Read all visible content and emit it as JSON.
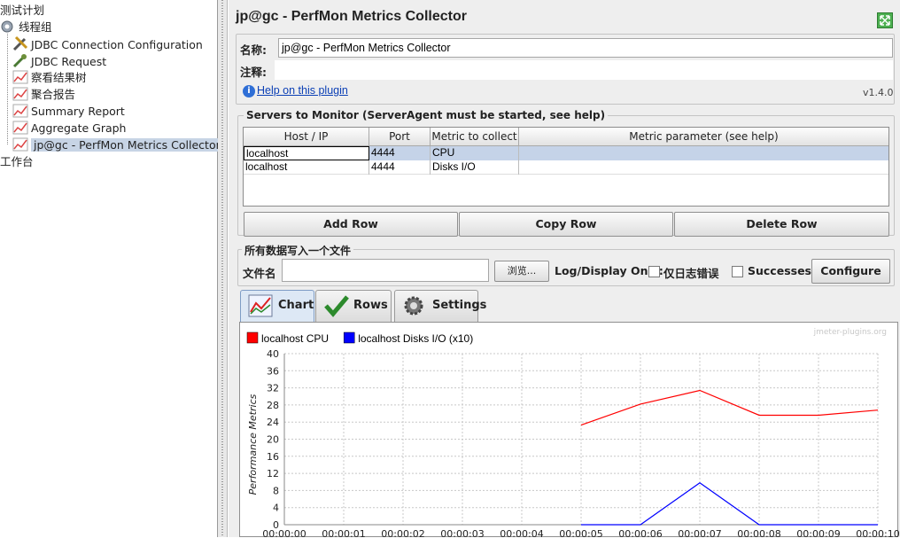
{
  "tree": {
    "root": "测试计划",
    "thread_group": "线程组",
    "children": [
      {
        "label": "JDBC Connection Configuration",
        "icon": "wrench-icon"
      },
      {
        "label": "JDBC Request",
        "icon": "pipette-icon"
      },
      {
        "label": "察看结果树",
        "icon": "graph-icon"
      },
      {
        "label": "聚合报告",
        "icon": "graph-icon"
      },
      {
        "label": "Summary Report",
        "icon": "graph-icon"
      },
      {
        "label": "Aggregate Graph",
        "icon": "graph-icon"
      },
      {
        "label": "jp@gc - PerfMon Metrics Collector",
        "icon": "graph-icon"
      }
    ],
    "workbench": "工作台"
  },
  "panel": {
    "title": "jp@gc - PerfMon Metrics Collector",
    "name_label": "名称:",
    "name_value": "jp@gc - PerfMon Metrics Collector",
    "comment_label": "注释:",
    "help_link": "Help on this plugin",
    "version": "v1.4.0"
  },
  "servers": {
    "group_title": "Servers to Monitor (ServerAgent must be started, see help)",
    "columns": [
      "Host / IP",
      "Port",
      "Metric to collect",
      "Metric parameter (see help)"
    ],
    "rows": [
      [
        "localhost",
        "4444",
        "CPU",
        ""
      ],
      [
        "localhost",
        "4444",
        "Disks I/O",
        ""
      ]
    ],
    "add_row": "Add Row",
    "copy_row": "Copy Row",
    "delete_row": "Delete Row"
  },
  "file": {
    "group_title": "所有数据写入一个文件",
    "filename_label": "文件名",
    "browse": "浏览...",
    "log_display_only": "Log/Display Only:",
    "errors_only": "仅日志错误",
    "successes": "Successes",
    "configure": "Configure"
  },
  "tabs": [
    {
      "label": "Chart",
      "icon": "chart-icon",
      "active": true
    },
    {
      "label": "Rows",
      "icon": "checkmark-icon",
      "active": false
    },
    {
      "label": "Settings",
      "icon": "gear-icon",
      "active": false
    }
  ],
  "chart_data": {
    "type": "line",
    "watermark": "jmeter-plugins.org",
    "ylabel": "Performance Metrics",
    "ylim": [
      0,
      40
    ],
    "yticks": [
      0,
      4,
      8,
      12,
      16,
      20,
      24,
      28,
      32,
      36,
      40
    ],
    "x": [
      "00:00:00",
      "00:00:01",
      "00:00:02",
      "00:00:03",
      "00:00:04",
      "00:00:05",
      "00:00:06",
      "00:00:07",
      "00:00:08",
      "00:00:09",
      "00:00:10"
    ],
    "series": [
      {
        "name": "localhost CPU",
        "color": "#ff0000",
        "points": [
          [
            5,
            23.3
          ],
          [
            6,
            28.2
          ],
          [
            7,
            31.4
          ],
          [
            8,
            25.6
          ],
          [
            9,
            25.6
          ],
          [
            10,
            26.8
          ]
        ]
      },
      {
        "name": "localhost Disks I/O (x10)",
        "color": "#0000ff",
        "points": [
          [
            5,
            0
          ],
          [
            6,
            0
          ],
          [
            7,
            9.8
          ],
          [
            8,
            0
          ],
          [
            9,
            0
          ],
          [
            10,
            0
          ]
        ]
      }
    ],
    "grid": true,
    "legend": "top-left"
  }
}
